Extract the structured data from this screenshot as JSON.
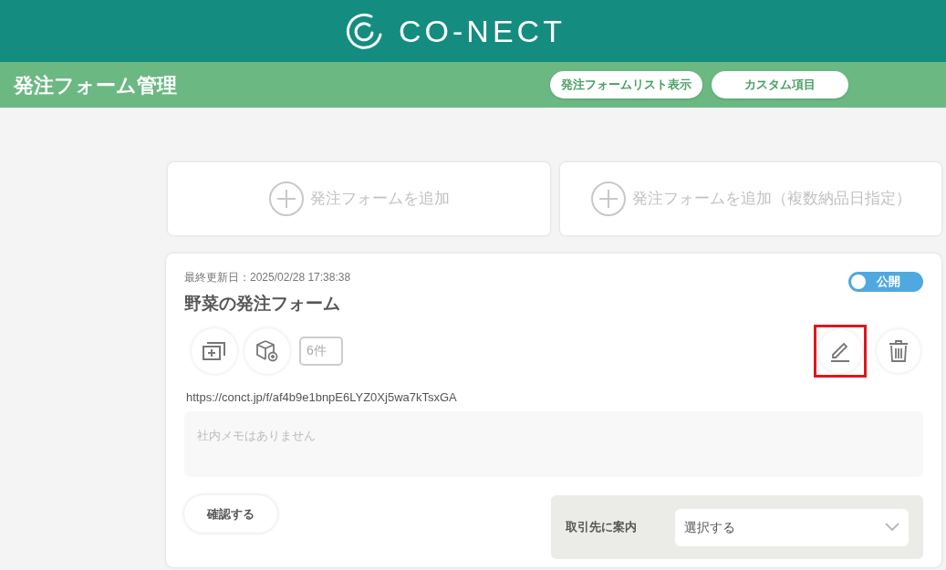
{
  "header": {
    "logo_text": "CO-NECT"
  },
  "page_bar": {
    "title": "発注フォーム管理",
    "buttons": [
      "発注フォームリスト表示",
      "カスタム項目"
    ]
  },
  "add_cards": [
    "発注フォームを追加",
    "発注フォームを追加（複数納品日指定）"
  ],
  "form_card": {
    "updated": "最終更新日：2025/02/28 17:38:38",
    "title": "野菜の発注フォーム",
    "published": true,
    "publish_label": "公開",
    "item_count": "6件",
    "actions": [
      {
        "kind": "edit",
        "highlighted": true
      },
      {
        "kind": "delete",
        "highlighted": false
      }
    ],
    "url": "https://conct.jp/f/af4b9e1bnpE6LYZ0Xj5wa7kTsxGA",
    "memo_placeholder": "社内メモはありません",
    "confirm_button": "確認する",
    "guide_label": "取引先に案内",
    "guide_select": "選択する"
  }
}
